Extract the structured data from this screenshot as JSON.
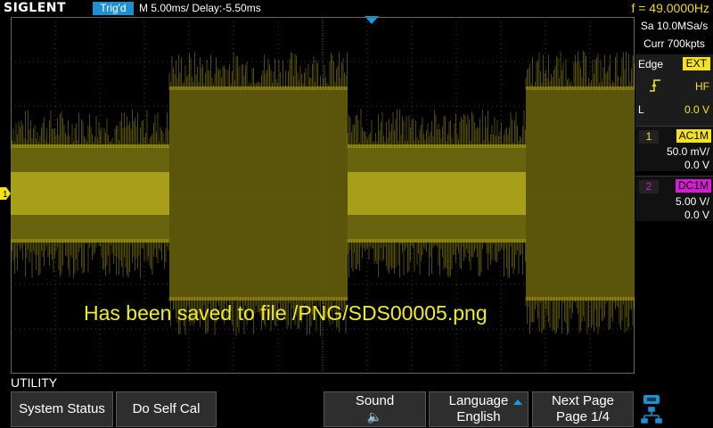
{
  "header": {
    "brand": "SIGLENT",
    "trigger_status": "Trig'd",
    "timebase": "M 5.00ms/ Delay:-5.50ms",
    "frequency": "f = 49.0000Hz"
  },
  "acquisition": {
    "sample_rate": "Sa 10.0MSa/s",
    "memory_depth": "Curr 700kpts"
  },
  "trigger": {
    "type": "Edge",
    "source": "EXT",
    "coupling": "HF",
    "level_label": "L",
    "level": "0.0 V"
  },
  "channels": [
    {
      "number": "1",
      "coupling": "AC1M",
      "scale": "50.0 mV/",
      "offset": "0.0 V",
      "color": "#f5e31a"
    },
    {
      "number": "2",
      "coupling": "DC1M",
      "scale": "5.00 V/",
      "offset": "0.0 V",
      "color": "#d41dd4"
    }
  ],
  "screen": {
    "ch1_marker": "1",
    "message": "Has been saved to file /PNG/SDS00005.png"
  },
  "menu": {
    "title": "UTILITY",
    "system_status": "System Status",
    "self_cal": "Do Self Cal",
    "sound_label": "Sound",
    "sound_icon": "🔈",
    "language_label": "Language",
    "language_value": "English",
    "next_page_label": "Next Page",
    "next_page_value": "Page 1/4"
  },
  "colors": {
    "accent_blue": "#1e8fcf",
    "trace_yellow": "#f5e31a",
    "ch2_magenta": "#d41dd4"
  }
}
